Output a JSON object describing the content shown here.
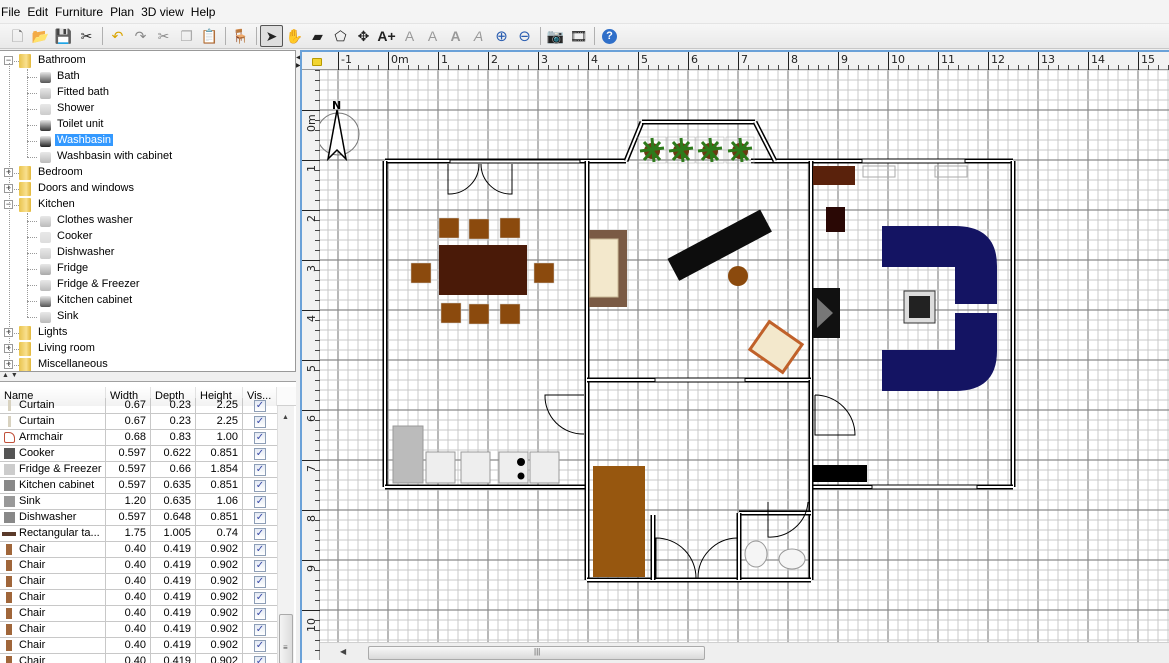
{
  "menubar": [
    "File",
    "Edit",
    "Furniture",
    "Plan",
    "3D view",
    "Help"
  ],
  "toolbar": [
    {
      "name": "new-home-icon",
      "glyph": "🗋"
    },
    {
      "name": "open-icon",
      "glyph": "📂"
    },
    {
      "name": "save-icon",
      "glyph": "💾"
    },
    {
      "name": "preferences-icon",
      "glyph": "✂"
    },
    {
      "sep": true
    },
    {
      "name": "undo-icon",
      "glyph": "↶"
    },
    {
      "name": "redo-icon",
      "glyph": "↷"
    },
    {
      "name": "cut-icon",
      "glyph": "✂"
    },
    {
      "name": "copy-icon",
      "glyph": "❐"
    },
    {
      "name": "paste-icon",
      "glyph": "📋"
    },
    {
      "sep": true
    },
    {
      "name": "add-furniture-icon",
      "glyph": "🪑"
    },
    {
      "sep": true
    },
    {
      "name": "select-mode-icon",
      "glyph": "➤",
      "active": true
    },
    {
      "name": "pan-mode-icon",
      "glyph": "✋"
    },
    {
      "name": "create-walls-icon",
      "glyph": "▰"
    },
    {
      "name": "create-rooms-icon",
      "glyph": "⬠"
    },
    {
      "name": "create-dimensions-icon",
      "glyph": "✥"
    },
    {
      "name": "add-text-icon",
      "glyph": "A+"
    },
    {
      "name": "increase-text-size-icon",
      "glyph": "A"
    },
    {
      "name": "decrease-text-size-icon",
      "glyph": "A"
    },
    {
      "name": "bold-text-icon",
      "glyph": "A"
    },
    {
      "name": "italic-text-icon",
      "glyph": "A"
    },
    {
      "name": "zoom-in-icon",
      "glyph": "⊕"
    },
    {
      "name": "zoom-out-icon",
      "glyph": "⊖"
    },
    {
      "sep": true
    },
    {
      "name": "create-photo-icon",
      "glyph": "📷"
    },
    {
      "name": "create-video-icon",
      "glyph": "🎞"
    },
    {
      "sep": true
    },
    {
      "name": "help-icon",
      "glyph": "?"
    }
  ],
  "catalog": {
    "categories": [
      {
        "label": "Bathroom",
        "expanded": true,
        "items": [
          "Bath",
          "Fitted bath",
          "Shower",
          "Toilet unit",
          "Washbasin",
          "Washbasin with cabinet"
        ]
      },
      {
        "label": "Bedroom",
        "expanded": false,
        "items": []
      },
      {
        "label": "Doors and windows",
        "expanded": false,
        "items": []
      },
      {
        "label": "Kitchen",
        "expanded": true,
        "items": [
          "Clothes washer",
          "Cooker",
          "Dishwasher",
          "Fridge",
          "Fridge & Freezer",
          "Kitchen cabinet",
          "Sink"
        ]
      },
      {
        "label": "Lights",
        "expanded": false,
        "items": []
      },
      {
        "label": "Living room",
        "expanded": false,
        "items": []
      },
      {
        "label": "Miscellaneous",
        "expanded": false,
        "items": []
      }
    ],
    "selected": "Washbasin"
  },
  "furniture_table": {
    "columns": [
      "Name",
      "Width",
      "Depth",
      "Height",
      "Vis..."
    ],
    "rows": [
      {
        "name": "Curtain",
        "width": "0.67",
        "depth": "0.23",
        "height": "2.25",
        "visible": true,
        "icon": "curtain"
      },
      {
        "name": "Curtain",
        "width": "0.67",
        "depth": "0.23",
        "height": "2.25",
        "visible": true,
        "icon": "curtain"
      },
      {
        "name": "Armchair",
        "width": "0.68",
        "depth": "0.83",
        "height": "1.00",
        "visible": true,
        "icon": "armchair"
      },
      {
        "name": "Cooker",
        "width": "0.597",
        "depth": "0.622",
        "height": "0.851",
        "visible": true,
        "icon": "cooker"
      },
      {
        "name": "Fridge & Freezer",
        "width": "0.597",
        "depth": "0.66",
        "height": "1.854",
        "visible": true,
        "icon": "fridge"
      },
      {
        "name": "Kitchen cabinet",
        "width": "0.597",
        "depth": "0.635",
        "height": "0.851",
        "visible": true,
        "icon": "cabinet"
      },
      {
        "name": "Sink",
        "width": "1.20",
        "depth": "0.635",
        "height": "1.06",
        "visible": true,
        "icon": "sink"
      },
      {
        "name": "Dishwasher",
        "width": "0.597",
        "depth": "0.648",
        "height": "0.851",
        "visible": true,
        "icon": "dishwasher"
      },
      {
        "name": "Rectangular ta...",
        "width": "1.75",
        "depth": "1.005",
        "height": "0.74",
        "visible": true,
        "icon": "table"
      },
      {
        "name": "Chair",
        "width": "0.40",
        "depth": "0.419",
        "height": "0.902",
        "visible": true,
        "icon": "chair"
      },
      {
        "name": "Chair",
        "width": "0.40",
        "depth": "0.419",
        "height": "0.902",
        "visible": true,
        "icon": "chair"
      },
      {
        "name": "Chair",
        "width": "0.40",
        "depth": "0.419",
        "height": "0.902",
        "visible": true,
        "icon": "chair"
      },
      {
        "name": "Chair",
        "width": "0.40",
        "depth": "0.419",
        "height": "0.902",
        "visible": true,
        "icon": "chair"
      },
      {
        "name": "Chair",
        "width": "0.40",
        "depth": "0.419",
        "height": "0.902",
        "visible": true,
        "icon": "chair"
      },
      {
        "name": "Chair",
        "width": "0.40",
        "depth": "0.419",
        "height": "0.902",
        "visible": true,
        "icon": "chair"
      },
      {
        "name": "Chair",
        "width": "0.40",
        "depth": "0.419",
        "height": "0.902",
        "visible": true,
        "icon": "chair"
      },
      {
        "name": "Chair",
        "width": "0.40",
        "depth": "0.419",
        "height": "0.902",
        "visible": true,
        "icon": "chair"
      }
    ]
  },
  "plan": {
    "unit_label": "m",
    "h_ruler_labels": [
      "-1",
      "0m",
      "1",
      "2",
      "3",
      "4",
      "5",
      "6",
      "7",
      "8",
      "9",
      "10",
      "11",
      "12",
      "13",
      "14",
      "15"
    ],
    "v_ruler_labels": [
      "0m",
      "1",
      "2",
      "3",
      "4",
      "5",
      "6",
      "7",
      "8",
      "9",
      "10"
    ],
    "compass_label": "N",
    "colors": {
      "wood": "#8b4a0d",
      "dark_wood": "#4a1a08",
      "sofa": "#141463",
      "black": "#0d0d0d",
      "plant": "#2d7a1a",
      "grid_major": "#8a8a8a",
      "grid_minor": "#c8c8c8",
      "selection": "#3399ff",
      "border": "#6aa1d8"
    }
  }
}
